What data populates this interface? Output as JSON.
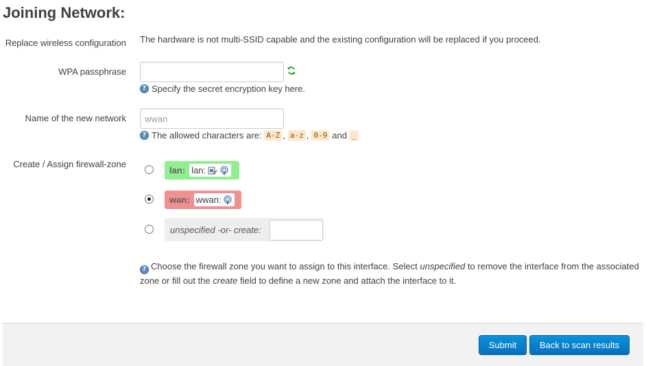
{
  "page": {
    "title": "Joining Network:"
  },
  "replace_config": {
    "label": "Replace wireless configuration",
    "text": "The hardware is not multi-SSID capable and the existing configuration will be replaced if you proceed."
  },
  "passphrase": {
    "label": "WPA passphrase",
    "value": "",
    "help": "Specify the secret encryption key here."
  },
  "network_name": {
    "label": "Name of the new network",
    "placeholder": "wwan",
    "help_prefix": "The allowed characters are:",
    "chars": [
      "A-Z",
      "a-z",
      "0-9",
      "_"
    ],
    "sep1": ",",
    "sep2": ",",
    "and_word": "and"
  },
  "firewall": {
    "label": "Create / Assign firewall-zone",
    "zones": [
      {
        "name": "lan:",
        "network": "lan:",
        "color": "#90f090",
        "selected": false
      },
      {
        "name": "wan:",
        "network": "wwan:",
        "color": "#f09090",
        "selected": true
      }
    ],
    "create_label": "unspecified -or- create:",
    "create_value": "",
    "help_part1": "Choose the firewall zone you want to assign to this interface. Select",
    "help_em1": "unspecified",
    "help_part2": "to remove the interface from the associated zone or fill out the",
    "help_em2": "create",
    "help_part3": "field to define a new zone and attach the interface to it."
  },
  "buttons": {
    "submit": "Submit",
    "back": "Back to scan results"
  },
  "colors": {
    "accent": "#0a84d0",
    "help_icon": "#5b8fc4",
    "lan_zone": "#90f090",
    "wan_zone": "#f09090"
  }
}
